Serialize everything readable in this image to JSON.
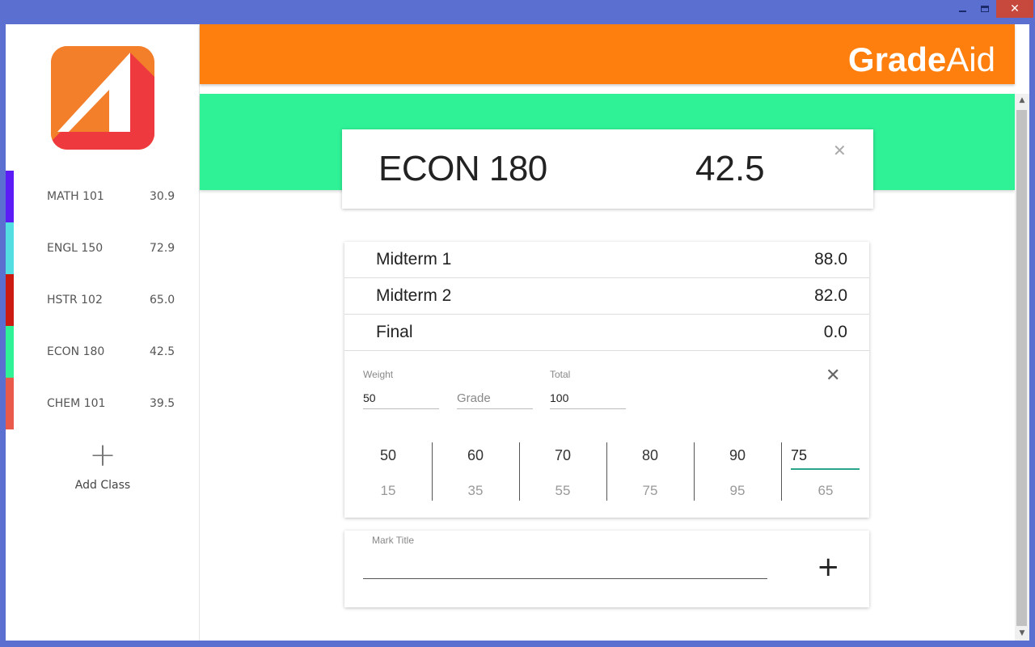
{
  "window": {
    "minimize_label": "",
    "close_label": "✕"
  },
  "app": {
    "brand_bold": "Grade",
    "brand_light": "Aid"
  },
  "sidebar": {
    "classes": [
      {
        "name": "MATH 101",
        "grade": "30.9",
        "color": "#5b1cf6"
      },
      {
        "name": "ENGL 150",
        "grade": "72.9",
        "color": "#53dfe1"
      },
      {
        "name": "HSTR 102",
        "grade": "65.0",
        "color": "#cc1a10"
      },
      {
        "name": "ECON 180",
        "grade": "42.5",
        "color": "#2ff196"
      },
      {
        "name": "CHEM 101",
        "grade": "39.5",
        "color": "#ea5a4a"
      }
    ],
    "add_class_icon": "+",
    "add_class_label": "Add Class"
  },
  "colors": {
    "header": "#ff7f0e",
    "banner": "#2ff196",
    "accent_underline": "#2aa58a",
    "logo_orange": "#f47f2a",
    "logo_red": "#ee3a3e"
  },
  "summary": {
    "title": "ECON 180",
    "grade": "42.5",
    "close_icon": "✕"
  },
  "marks": [
    {
      "name": "Midterm 1",
      "value": "88.0"
    },
    {
      "name": "Midterm 2",
      "value": "82.0"
    },
    {
      "name": "Final",
      "value": "0.0"
    }
  ],
  "edit": {
    "weight_label": "Weight",
    "weight_value": "50",
    "grade_placeholder": "Grade",
    "total_label": "Total",
    "total_value": "100",
    "close_icon": "✕",
    "projections": [
      {
        "top": "50",
        "bottom": "15"
      },
      {
        "top": "60",
        "bottom": "35"
      },
      {
        "top": "70",
        "bottom": "55"
      },
      {
        "top": "80",
        "bottom": "75"
      },
      {
        "top": "90",
        "bottom": "95"
      }
    ],
    "custom_projection": {
      "input": "75",
      "bottom": "65"
    }
  },
  "add_mark": {
    "label": "Mark Title",
    "value": "",
    "plus_icon": "+"
  }
}
